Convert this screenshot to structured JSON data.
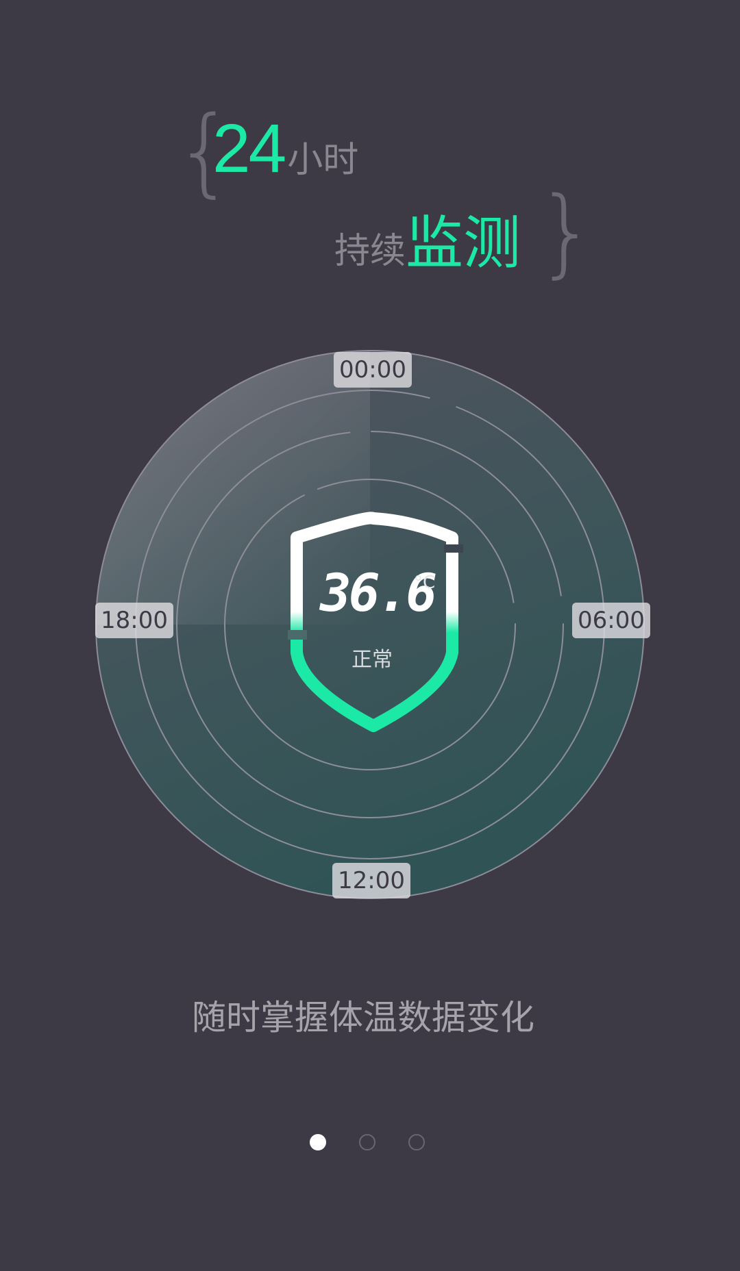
{
  "headline": {
    "number": "24",
    "unit": "小时",
    "prefix": "持续",
    "highlight": "监测",
    "open_brace": "{",
    "close_brace": "}"
  },
  "dial": {
    "labels": {
      "top": "00:00",
      "right": "06:00",
      "bottom": "12:00",
      "left": "18:00"
    },
    "temperature": "36.6",
    "temperature_unit": "°C",
    "status": "正常"
  },
  "caption": "随时掌握体温数据变化",
  "pager": {
    "total": 3,
    "active": 1
  },
  "colors": {
    "background": "#3d3a46",
    "accent": "#1de9a6",
    "muted_text": "#8a8791"
  }
}
